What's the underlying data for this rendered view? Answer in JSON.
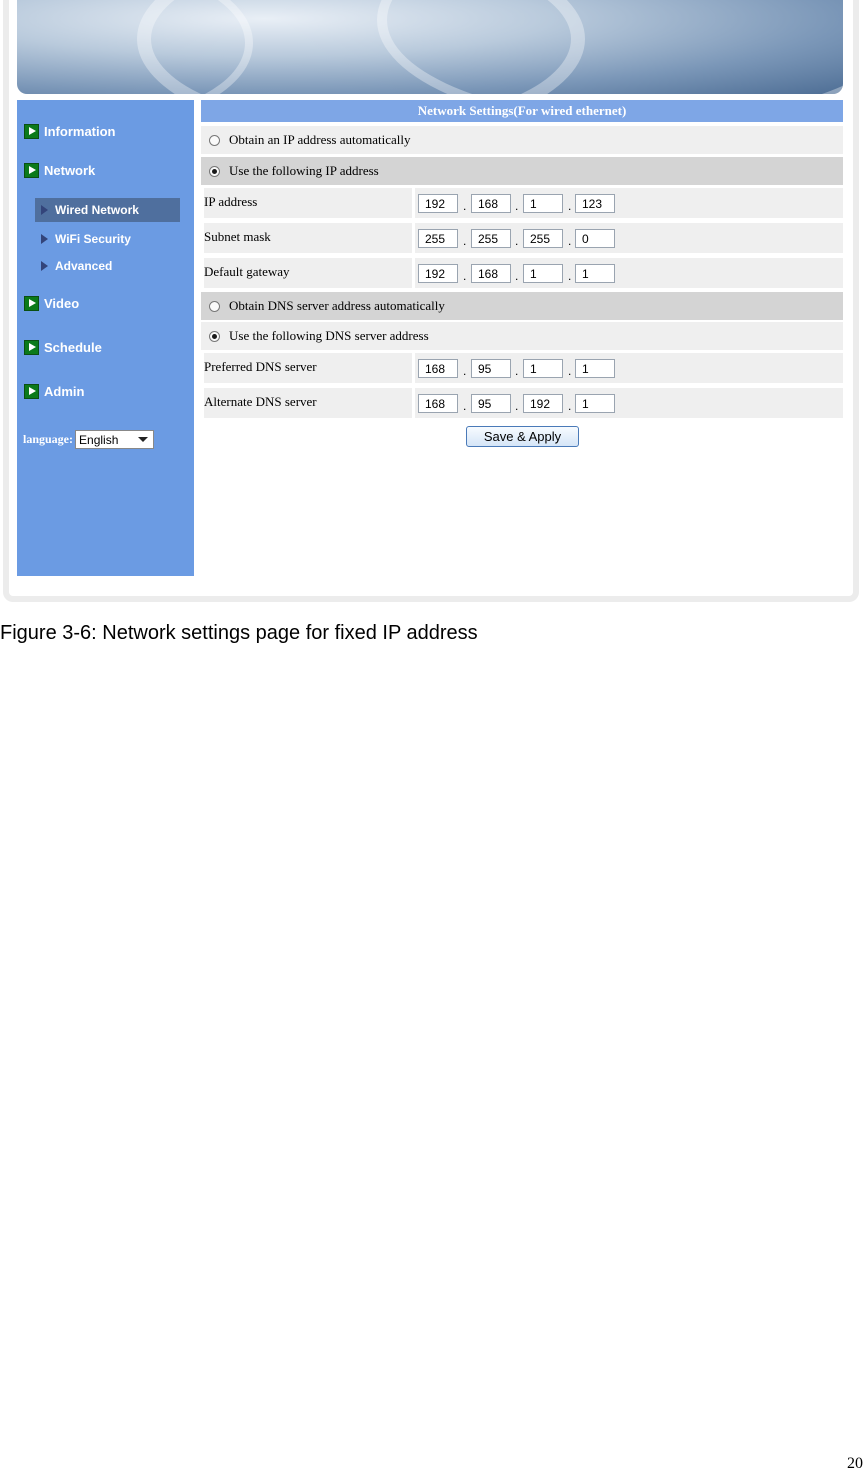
{
  "nav": {
    "items": [
      {
        "label": "Information"
      },
      {
        "label": "Network"
      },
      {
        "label": "Video"
      },
      {
        "label": "Schedule"
      },
      {
        "label": "Admin"
      }
    ],
    "subitems": [
      {
        "label": "Wired Network",
        "active": true
      },
      {
        "label": "WiFi Security",
        "active": false
      },
      {
        "label": "Advanced",
        "active": false
      }
    ],
    "language_label": "language:",
    "language_value": "English"
  },
  "panel": {
    "title": "Network Settings(For wired ethernet)",
    "ip_auto_label": "Obtain an IP address automatically",
    "ip_manual_label": "Use the following IP address",
    "ip_mode": "manual",
    "fields": [
      {
        "label": "IP address",
        "octets": [
          "192",
          "168",
          "1",
          "123"
        ]
      },
      {
        "label": "Subnet mask",
        "octets": [
          "255",
          "255",
          "255",
          "0"
        ]
      },
      {
        "label": "Default gateway",
        "octets": [
          "192",
          "168",
          "1",
          "1"
        ]
      }
    ],
    "dns_auto_label": "Obtain DNS server address automatically",
    "dns_manual_label": "Use the following DNS server address",
    "dns_mode": "manual",
    "dns_fields": [
      {
        "label": "Preferred DNS server",
        "octets": [
          "168",
          "95",
          "1",
          "1"
        ]
      },
      {
        "label": "Alternate DNS server",
        "octets": [
          "168",
          "95",
          "192",
          "1"
        ]
      }
    ],
    "save_label": "Save & Apply"
  },
  "caption": "Figure 3-6: Network settings page for fixed IP address",
  "page_number": "20"
}
